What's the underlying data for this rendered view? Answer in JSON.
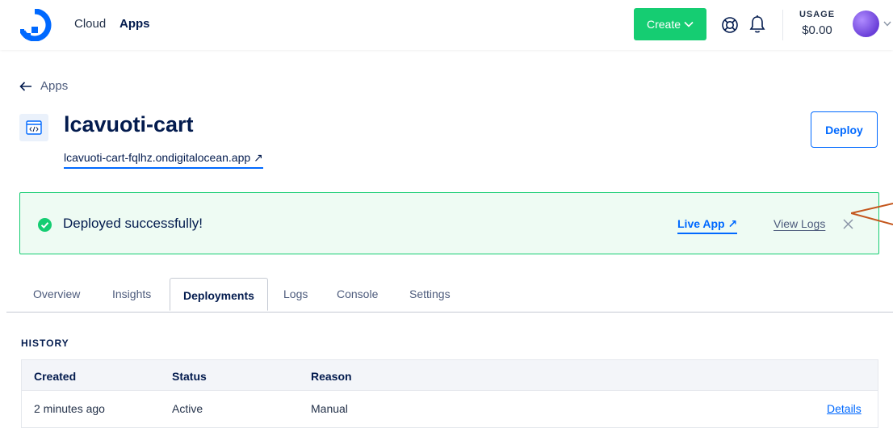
{
  "header": {
    "nav_cloud": "Cloud",
    "nav_apps": "Apps",
    "create_label": "Create",
    "usage_label": "USAGE",
    "usage_value": "$0.00"
  },
  "breadcrumb": {
    "back_label": "Apps"
  },
  "app": {
    "title": "lcavuoti-cart",
    "url": "lcavuoti-cart-fqlhz.ondigitalocean.app",
    "link_arrow": "↗",
    "deploy_label": "Deploy"
  },
  "banner": {
    "message": "Deployed successfully!",
    "live_app": "Live App",
    "view_logs": "View Logs"
  },
  "tabs": [
    {
      "label": "Overview",
      "active": false
    },
    {
      "label": "Insights",
      "active": false
    },
    {
      "label": "Deployments",
      "active": true
    },
    {
      "label": "Logs",
      "active": false
    },
    {
      "label": "Console",
      "active": false
    },
    {
      "label": "Settings",
      "active": false
    }
  ],
  "history": {
    "label": "HISTORY",
    "columns": [
      "Created",
      "Status",
      "Reason"
    ],
    "rows": [
      {
        "created": "2 minutes ago",
        "status": "Active",
        "reason": "Manual",
        "action": "Details"
      }
    ]
  },
  "colors": {
    "brand": "#0069ff",
    "success": "#15cd72",
    "annotation": "#c4561c"
  },
  "icons": [
    "digitalocean-logo-icon",
    "chevron-down-icon",
    "support-icon",
    "bell-icon",
    "arrow-left-icon",
    "app-code-icon",
    "external-link-icon",
    "check-circle-icon",
    "close-icon"
  ]
}
